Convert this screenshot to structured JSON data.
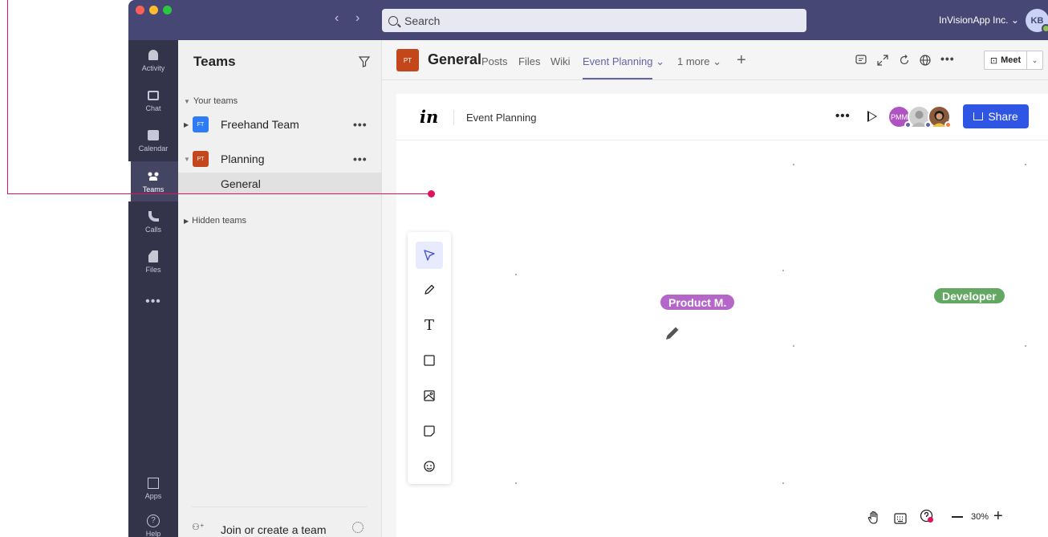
{
  "window": {
    "search_placeholder": "Search",
    "org_name": "InVisionApp Inc.",
    "org_chevron": "⌄",
    "user_initials": "KB",
    "nav_back": "‹",
    "nav_forward": "›"
  },
  "rail": {
    "items": [
      {
        "label": "Activity",
        "icon": "bell-icon"
      },
      {
        "label": "Chat",
        "icon": "chat-icon"
      },
      {
        "label": "Calendar",
        "icon": "calendar-icon"
      },
      {
        "label": "Teams",
        "icon": "teams-icon"
      },
      {
        "label": "Calls",
        "icon": "phone-icon"
      },
      {
        "label": "Files",
        "icon": "file-icon"
      }
    ],
    "more": "•••",
    "apps_label": "Apps",
    "help_label": "Help",
    "help_glyph": "?"
  },
  "teams_panel": {
    "title": "Teams",
    "your_teams_label": "Your teams",
    "teams": [
      {
        "initials": "FT",
        "name": "Freehand Team",
        "color": "#2d7cf6"
      },
      {
        "initials": "PT",
        "name": "Planning",
        "color": "#c4461b"
      }
    ],
    "team_more": "•••",
    "channel": "General",
    "hidden_teams_label": "Hidden teams",
    "join_label": "Join or create a team"
  },
  "channel_header": {
    "team_initials": "PT",
    "channel_name": "General",
    "tabs": [
      "Posts",
      "Files",
      "Wiki",
      "Event Planning",
      "1 more"
    ],
    "active_tab": "Event Planning",
    "add_tab": "+",
    "more": "•••",
    "meet_label": "Meet"
  },
  "freehand": {
    "logo": "in",
    "doc_title": "Event Planning",
    "more": "•••",
    "collaborators": [
      {
        "initials": "PMM",
        "color": "#b053c2",
        "presence": "#6264a7"
      },
      {
        "initials": "",
        "color": "#cfcfcf",
        "presence": "#6264a7"
      },
      {
        "initials": "",
        "color": "#8a5a3c",
        "presence": "#f47c3c"
      }
    ],
    "share_label": "Share",
    "tools": [
      "pointer-icon",
      "pen-icon",
      "text-icon",
      "rectangle-icon",
      "image-icon",
      "sticky-note-icon",
      "sticker-icon"
    ],
    "text_tool_glyph": "T",
    "active_tool": "pointer-icon",
    "cursors": [
      {
        "label": "Product M.",
        "color": "#b467c8"
      },
      {
        "label": "Developer",
        "color": "#62a863"
      }
    ],
    "zoom": "30%",
    "zoom_minus": "−",
    "zoom_plus": "+"
  },
  "colors": {
    "titlebar": "#464775",
    "rail": "#33344a",
    "accent": "#6264a7",
    "share_blue": "#2f55e4",
    "pointer_line": "#e0115f"
  }
}
